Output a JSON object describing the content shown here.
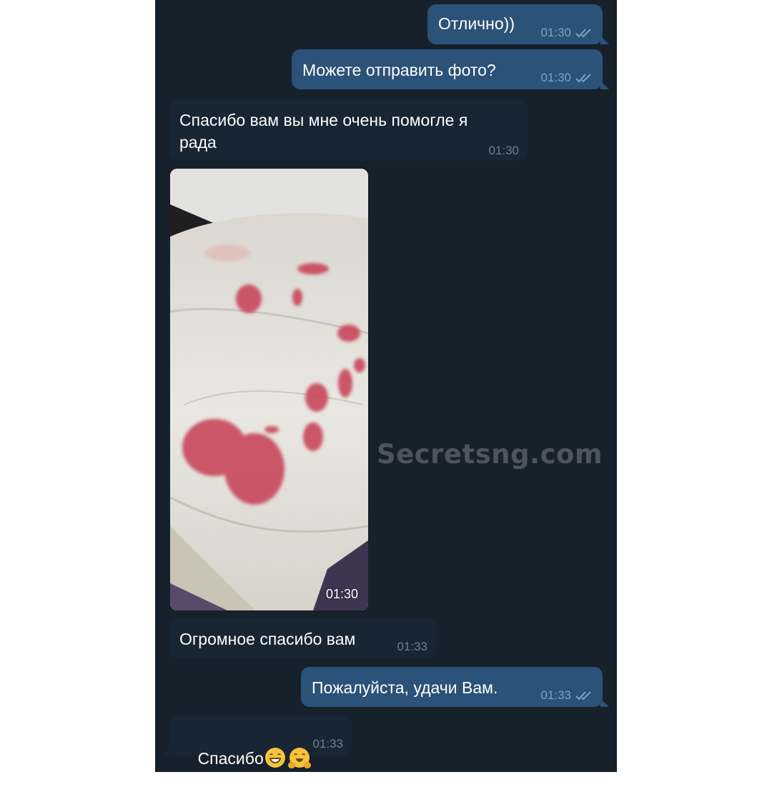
{
  "watermark": "Secretsng.com",
  "colors": {
    "chat_background": "#17212b",
    "outgoing_bubble": "#2b5278",
    "incoming_bubble": "#182533",
    "outgoing_meta": "#7aa3c7",
    "incoming_meta": "#6d7f8f"
  },
  "messages": [
    {
      "direction": "outgoing",
      "text": "Отлично))",
      "time": "01:30",
      "status": "read-double-check-icon"
    },
    {
      "direction": "outgoing",
      "text": "Можете отправить фото?",
      "time": "01:30",
      "status": "read-double-check-icon"
    },
    {
      "direction": "incoming",
      "text": "Спасибо вам вы мне очень помогле я\nрада",
      "time": "01:30"
    },
    {
      "direction": "incoming",
      "type": "photo",
      "caption_time": "01:30"
    },
    {
      "direction": "incoming",
      "text": "Огромное спасибо вам",
      "time": "01:33"
    },
    {
      "direction": "outgoing",
      "text": "Пожалуйста, удачи Вам.",
      "time": "01:33",
      "status": "read-double-check-icon"
    },
    {
      "direction": "incoming",
      "text": "Спасибо",
      "emoji": [
        "grinning-face-icon",
        "hugging-face-icon"
      ],
      "time": "01:33"
    }
  ]
}
